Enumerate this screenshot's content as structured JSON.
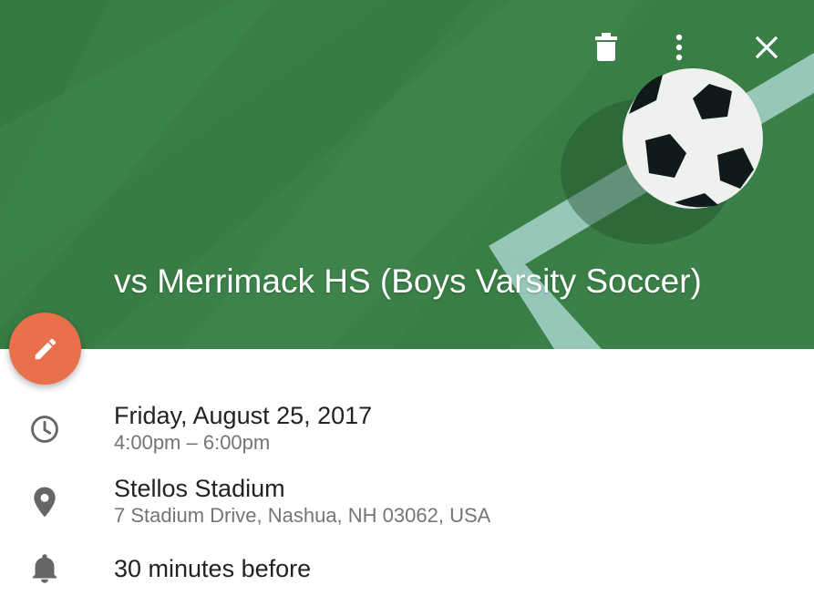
{
  "header": {
    "title": "vs Merrimack HS (Boys Varsity Soccer)",
    "background_color": "#3b8048",
    "illustration": "soccer-ball-illustration"
  },
  "toolbar": {
    "delete_icon": "trash-icon",
    "more_icon": "more-vert-icon",
    "close_icon": "close-icon"
  },
  "fab": {
    "icon": "pencil-icon",
    "color": "#e8704b"
  },
  "details": {
    "date": "Friday, August 25, 2017",
    "time": "4:00pm – 6:00pm",
    "location_name": "Stellos Stadium",
    "location_address": "7 Stadium Drive, Nashua, NH 03062, USA",
    "reminder": "30 minutes before",
    "icons": [
      "clock-icon",
      "location-pin-icon",
      "bell-icon"
    ]
  }
}
